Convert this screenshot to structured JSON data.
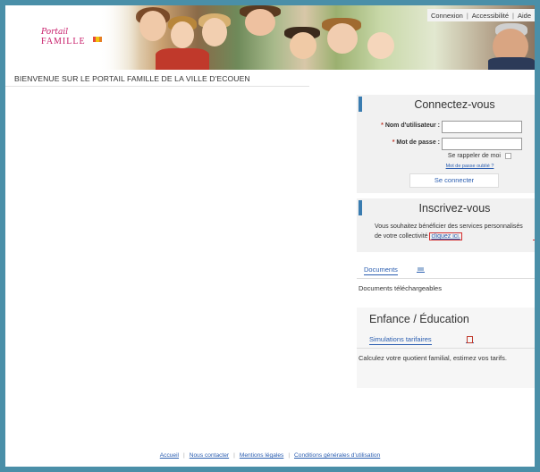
{
  "logo": {
    "script": "Portail",
    "word": "FAMILLE"
  },
  "top_links": [
    "Connexion",
    "Accessibilité",
    "Aide"
  ],
  "top_links_separator": "|",
  "welcome": "BIENVENUE SUR LE PORTAIL FAMILLE DE LA VILLE D'ECOUEN",
  "login": {
    "title": "Connectez-vous",
    "username_label": "Nom d'utilisateur :",
    "password_label": "Mot de passe :",
    "required_mark": "*",
    "username_value": "",
    "password_value": "",
    "remember": "Se rappeler de moi",
    "forgot": "Mot de passe oublié ?",
    "submit": "Se connecter"
  },
  "register": {
    "title": "Inscrivez-vous",
    "text": "Vous souhaitez bénéficier des services personnalisés de votre collectivité",
    "link": "cliquez ici."
  },
  "documents": {
    "tab": "Documents",
    "text": "Documents téléchargeables"
  },
  "enfance": {
    "title": "Enfance / Éducation",
    "tab": "Simulations tarifaires",
    "text": "Calculez votre quotient familial, estimez vos tarifs."
  },
  "footer": [
    "Accueil",
    "Nous contacter",
    "Mentions légales",
    "Conditions générales d'utilisation"
  ],
  "footer_separator": "|",
  "colors": {
    "accent": "#3a7cb0",
    "link": "#2a5db0",
    "highlight": "#d62e2e",
    "logo": "#c81d6a",
    "frame": "#4a8fa8"
  }
}
